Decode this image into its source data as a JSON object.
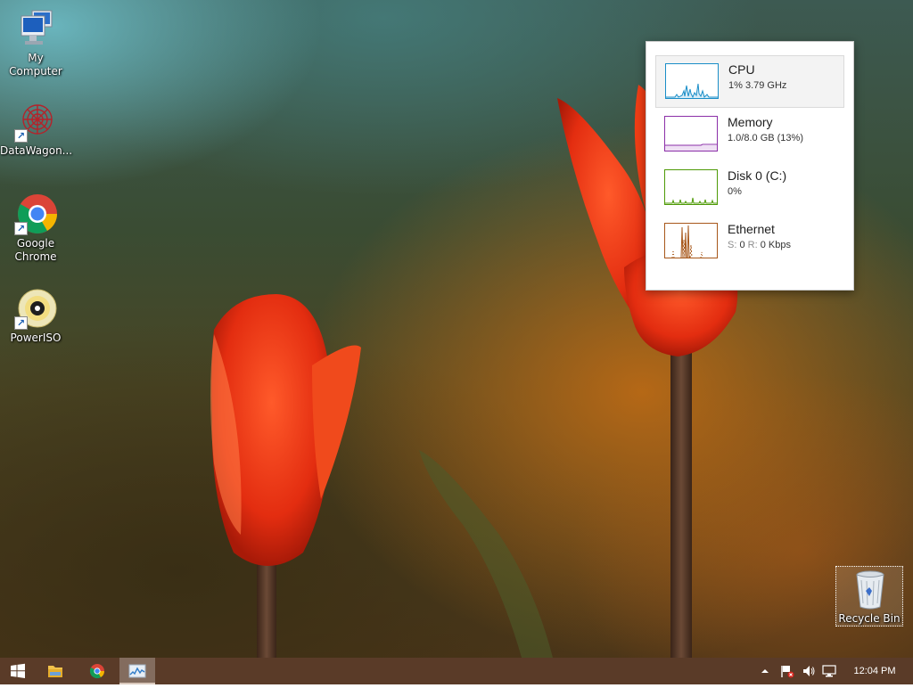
{
  "desktop": {
    "icons": [
      {
        "label": "My Computer",
        "icon": "computer-icon"
      },
      {
        "label": "DataWagon...",
        "icon": "datawagon-icon",
        "shortcut": true
      },
      {
        "label": "Google Chrome",
        "icon": "chrome-icon",
        "shortcut": true
      },
      {
        "label": "PowerISO",
        "icon": "poweriso-icon",
        "shortcut": true
      }
    ],
    "recycle_bin": {
      "label": "Recycle Bin",
      "icon": "recycle-bin-icon"
    }
  },
  "performance": {
    "items": [
      {
        "name": "CPU",
        "value": "1%  3.79 GHz",
        "color": "#1a8ec8",
        "selected": true
      },
      {
        "name": "Memory",
        "value": "1.0/8.0 GB (13%)",
        "color": "#8b2fa8"
      },
      {
        "name": "Disk 0 (C:)",
        "value": "0%",
        "color": "#4e9a06"
      },
      {
        "name": "Ethernet",
        "send_label": "S:",
        "send_value": "0",
        "recv_label": "R:",
        "recv_value": "0 Kbps",
        "color": "#a7571a"
      }
    ]
  },
  "taskbar": {
    "buttons": [
      {
        "name": "start-button",
        "icon": "windows-logo-icon"
      },
      {
        "name": "file-explorer-button",
        "icon": "folder-icon"
      },
      {
        "name": "chrome-button",
        "icon": "chrome-icon"
      },
      {
        "name": "task-manager-button",
        "icon": "task-manager-icon",
        "active": true
      }
    ],
    "tray": [
      "chevron-up-icon",
      "action-center-flag-icon",
      "speaker-icon",
      "network-icon"
    ],
    "clock": "12:04 PM",
    "color": "#5a3b28"
  }
}
